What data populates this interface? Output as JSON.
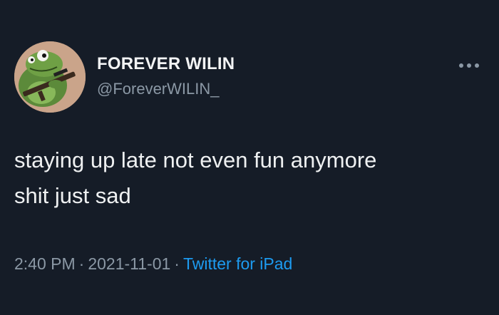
{
  "tweet": {
    "author": {
      "display_name": "FOREVER WILIN",
      "handle": "@ForeverWILIN_",
      "avatar_icon": "frog-avatar-icon"
    },
    "more_icon": "more-horizontal-icon",
    "text_lines": [
      "staying up late not even fun anymore",
      "shit just sad"
    ],
    "time": "2:40 PM",
    "separator": "·",
    "date": "2021-11-01",
    "source": "Twitter for iPad"
  },
  "colors": {
    "background": "#151c27",
    "text": "#e7e9ea",
    "muted": "#8b98a5",
    "link": "#1d9bf0"
  }
}
